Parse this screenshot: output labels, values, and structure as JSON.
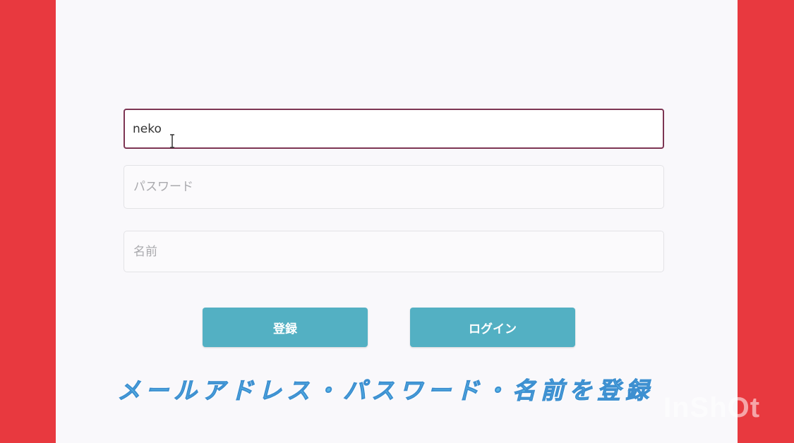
{
  "form": {
    "email": {
      "value": "neko",
      "placeholder": ""
    },
    "password": {
      "value": "",
      "placeholder": "パスワード"
    },
    "name": {
      "value": "",
      "placeholder": "名前"
    }
  },
  "buttons": {
    "register_label": "登録",
    "login_label": "ログイン"
  },
  "caption": "メールアドレス・パスワード・名前を登録",
  "watermark": "InShOt",
  "colors": {
    "side_background": "#e8393f",
    "app_background": "#f9f8fb",
    "button": "#53b0c3",
    "focus_border": "#7d3553",
    "caption": "#58b6e6"
  }
}
